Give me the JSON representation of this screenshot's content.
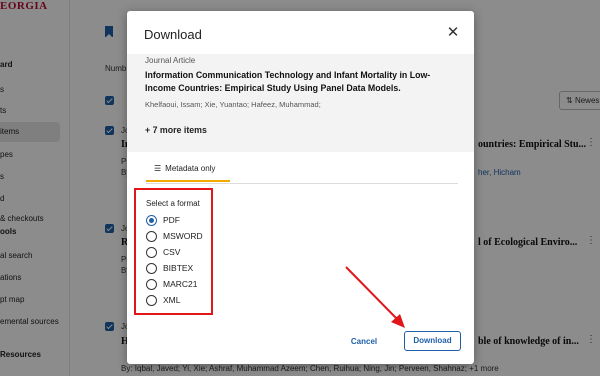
{
  "background": {
    "brand": "EORGIA",
    "sidebar_items": [
      {
        "label": "ard",
        "bold": true
      },
      {
        "label": "s",
        "bold": false
      },
      {
        "label": "ts",
        "bold": false
      },
      {
        "label": "items",
        "bold": false,
        "active": true
      },
      {
        "label": "pes",
        "bold": false
      },
      {
        "label": "s",
        "bold": false
      },
      {
        "label": "d",
        "bold": false
      },
      {
        "label": "& checkouts",
        "bold": false
      },
      {
        "label": "ools",
        "bold": true
      },
      {
        "label": "al search",
        "bold": false
      },
      {
        "label": "ations",
        "bold": false
      },
      {
        "label": "pt map",
        "bold": false
      },
      {
        "label": "emental sources",
        "bold": false
      },
      {
        "label": "Resources",
        "bold": true
      }
    ],
    "numb_label": "Numb",
    "sort_label": "Newes",
    "rows": [
      {
        "type": "Jo",
        "title_start": "In",
        "title_end": "ountries: Empirical Stu...",
        "pub": "Pu",
        "by": "By",
        "author_end": "her, Hicham"
      },
      {
        "type": "Jo",
        "title_start": "Re",
        "title_end": "l of Ecological Enviro...",
        "pub": "Pu",
        "by": "By"
      },
      {
        "type": "Jo",
        "title_start": "H",
        "title_end": "ble of knowledge of in...",
        "by_full": "By: Iqbal, Javed; Yi, Xie; Ashraf, Muhammad Azeem; Chen, Ruihua; Ning, Jin; Perveen, Shahnaz; +1 more"
      }
    ]
  },
  "modal": {
    "title": "Download",
    "close_icon": "close-icon",
    "item_type": "Journal Article",
    "article_title": "Information Communication Technology and Infant Mortality in Low-Income Countries: Empirical Study Using Panel Data Models.",
    "authors": "Khelfaoui, Issam; Xie, Yuantao; Hafeez, Muhammad;",
    "more_items": "+ 7 more items",
    "tab_label": "Metadata only",
    "format_label": "Select a format",
    "formats": [
      "PDF",
      "MSWORD",
      "CSV",
      "BIBTEX",
      "MARC21",
      "XML"
    ],
    "selected_format": "PDF",
    "cancel_label": "Cancel",
    "download_label": "Download"
  },
  "colors": {
    "accent": "#1f5fa8",
    "highlight": "#e0161b",
    "tab_underline": "#f2a900",
    "brand": "#ba0c2f"
  }
}
